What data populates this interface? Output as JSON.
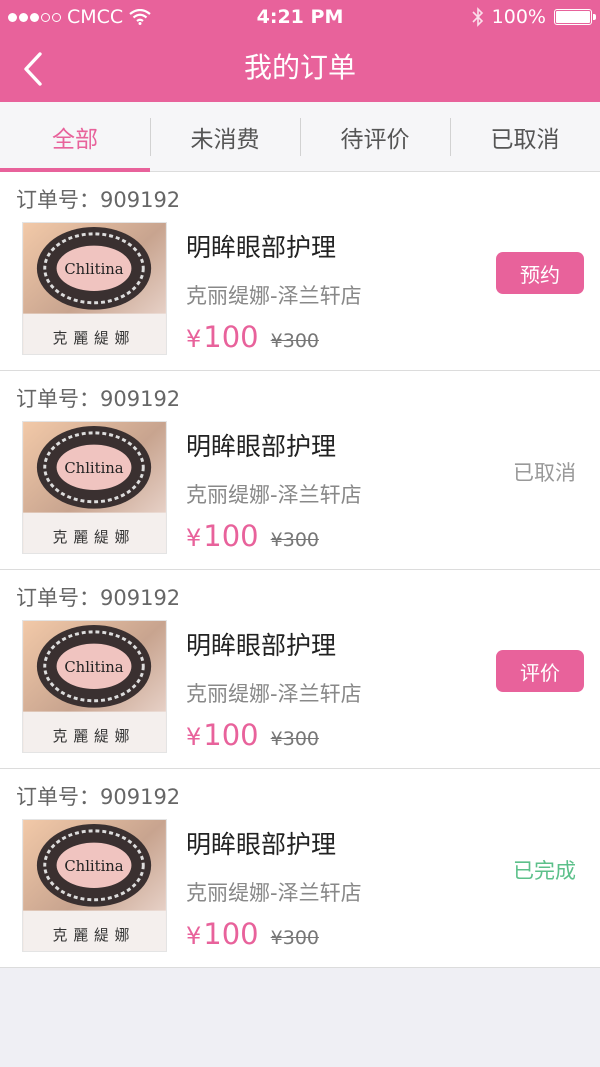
{
  "status_bar": {
    "carrier": "CMCC",
    "time": "4:21 PM",
    "battery": "100%"
  },
  "nav": {
    "title": "我的订单"
  },
  "tabs": [
    {
      "label": "全部"
    },
    {
      "label": "未消费"
    },
    {
      "label": "待评价"
    },
    {
      "label": "已取消"
    }
  ],
  "orders": [
    {
      "order_no": "订单号：909192",
      "logo_text": "Chlitina",
      "logo_cn": "克麗緹娜",
      "service": "明眸眼部护理",
      "store": "克丽缇娜-泽兰轩店",
      "currency": "¥",
      "price": "100",
      "original_price": "¥300",
      "action": "预约",
      "status": ""
    },
    {
      "order_no": "订单号：909192",
      "logo_text": "Chlitina",
      "logo_cn": "克麗緹娜",
      "service": "明眸眼部护理",
      "store": "克丽缇娜-泽兰轩店",
      "currency": "¥",
      "price": "100",
      "original_price": "¥300",
      "action": "",
      "status": "已取消"
    },
    {
      "order_no": "订单号：909192",
      "logo_text": "Chlitina",
      "logo_cn": "克麗緹娜",
      "service": "明眸眼部护理",
      "store": "克丽缇娜-泽兰轩店",
      "currency": "¥",
      "price": "100",
      "original_price": "¥300",
      "action": "评价",
      "status": ""
    },
    {
      "order_no": "订单号：909192",
      "logo_text": "Chlitina",
      "logo_cn": "克麗緹娜",
      "service": "明眸眼部护理",
      "store": "克丽缇娜-泽兰轩店",
      "currency": "¥",
      "price": "100",
      "original_price": "¥300",
      "action": "",
      "status": "已完成"
    }
  ],
  "colors": {
    "brand": "#e8629b",
    "cancelled": "#999999",
    "completed": "#5cc08a"
  },
  "icons": {
    "back": "chevron-left-icon",
    "wifi": "wifi-icon",
    "bluetooth": "bluetooth-icon",
    "battery": "battery-icon"
  }
}
